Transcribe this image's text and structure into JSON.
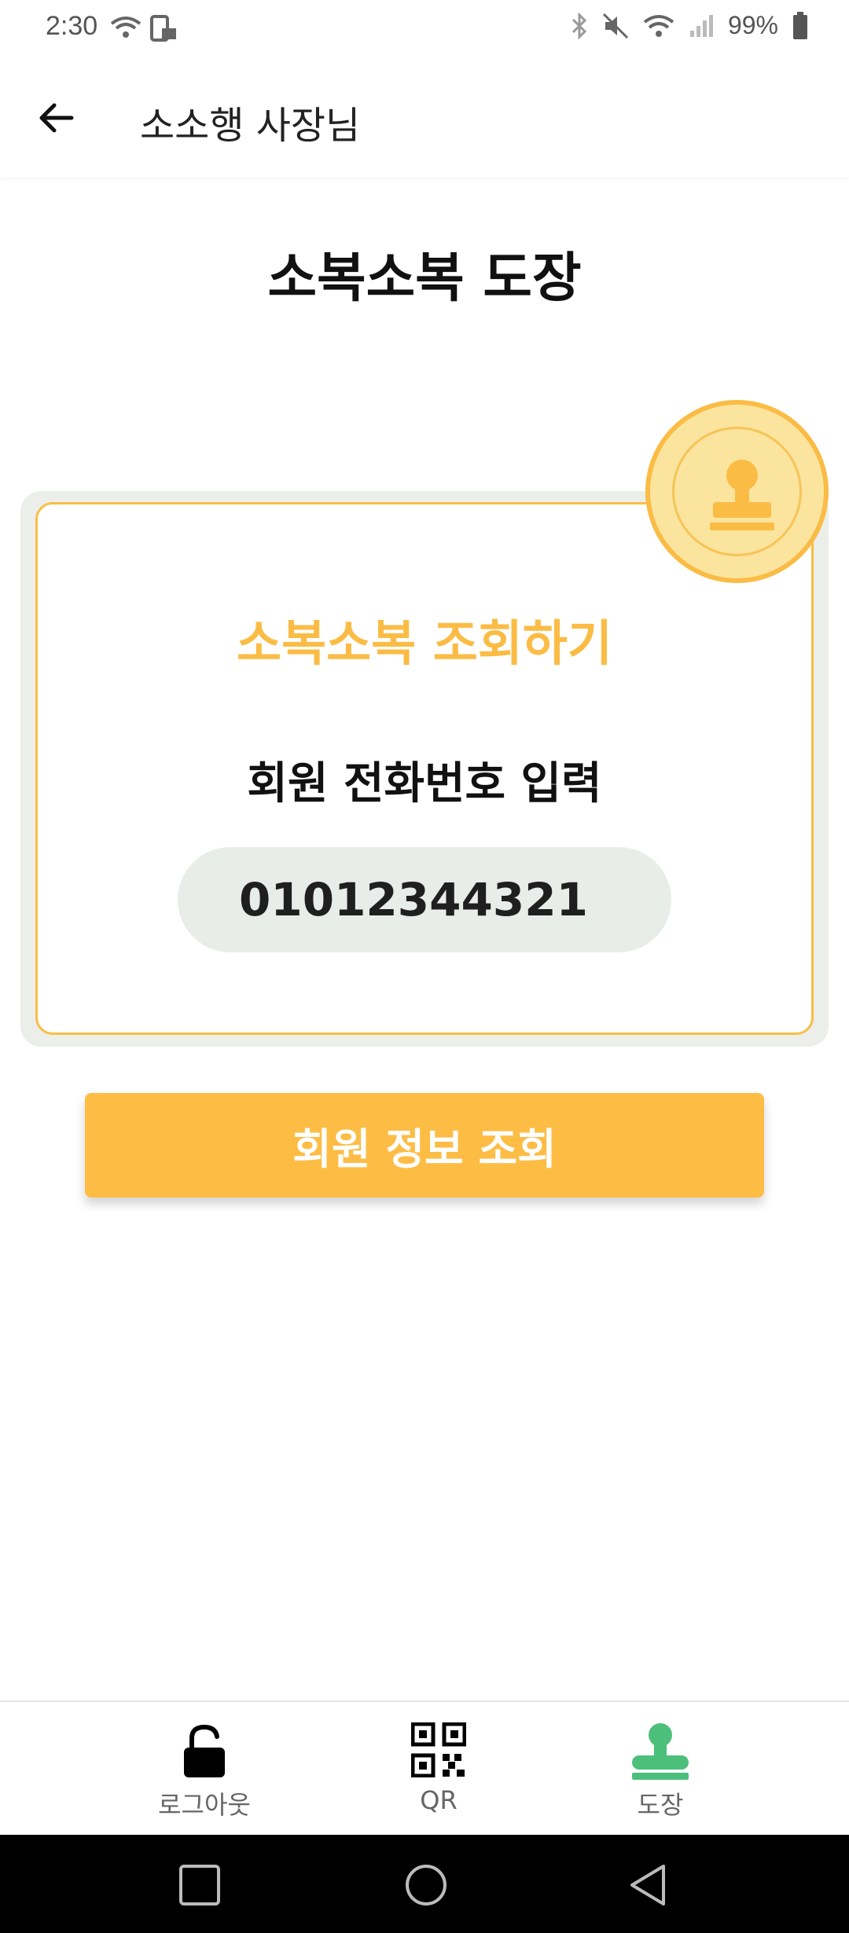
{
  "status_bar": {
    "time": "2:30",
    "battery": "99%"
  },
  "app_bar": {
    "title": "소소행 사장님"
  },
  "page": {
    "title": "소복소복 도장"
  },
  "card": {
    "title": "소복소복 조회하기",
    "field_label": "회원 전화번호 입력",
    "phone_value": "01012344321"
  },
  "actions": {
    "lookup_label": "회원 정보 조회"
  },
  "bottom_nav": {
    "items": [
      {
        "label": "로그아웃",
        "icon": "unlock-icon"
      },
      {
        "label": "QR",
        "icon": "qr-code-icon"
      },
      {
        "label": "도장",
        "icon": "stamp-icon",
        "active": true
      }
    ]
  },
  "colors": {
    "accent": "#FDBD45",
    "card_bg": "#EBEEE9",
    "active_nav": "#4CC07A"
  }
}
